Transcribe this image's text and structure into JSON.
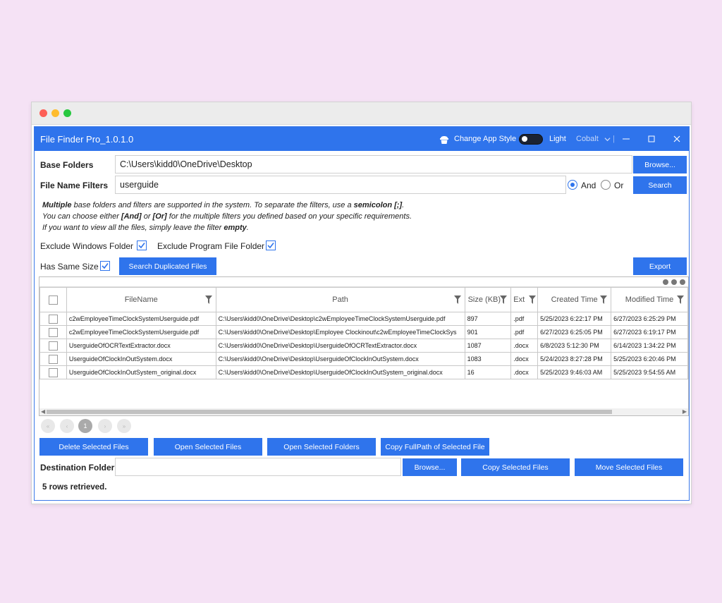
{
  "window": {
    "title": "File Finder Pro_1.0.1.0",
    "change_style_label": "Change App Style",
    "theme_label": "Light",
    "accent_label": "Cobalt",
    "accent_color": "#2f74ec"
  },
  "base_folders": {
    "label": "Base Folders",
    "value": "C:\\Users\\kidd0\\OneDrive\\Desktop",
    "browse_label": "Browse..."
  },
  "filters": {
    "label": "File Name Filters",
    "value": "userguide",
    "and_label": "And",
    "or_label": "Or",
    "selected": "And",
    "search_label": "Search"
  },
  "info": {
    "line1_b1": "Multiple",
    "line1_t1": " base folders and filters are supported in the system. To separate the filters, use a ",
    "line1_b2": "semicolon [;]",
    "line1_t2": ".",
    "line2_t1": "You can choose either ",
    "line2_b1": "[And]",
    "line2_t2": " or ",
    "line2_b2": "[Or]",
    "line2_t3": " for the multiple filters you defined based on your specific requirements.",
    "line3_t1": "If you want to view all the files, simply leave the filter ",
    "line3_b1": "empty",
    "line3_t2": "."
  },
  "options": {
    "exclude_windows_label": "Exclude Windows Folder",
    "exclude_windows": true,
    "exclude_program_label": "Exclude Program File Folder",
    "exclude_program": true,
    "same_size_label": "Has Same Size",
    "same_size": true,
    "search_duplicated_label": "Search Duplicated Files",
    "export_label": "Export"
  },
  "grid": {
    "columns": [
      "FileName",
      "Path",
      "Size (KB)",
      "Ext",
      "Created Time",
      "Modified Time"
    ],
    "rows": [
      [
        "c2wEmployeeTimeClockSystemUserguide.pdf",
        "C:\\Users\\kidd0\\OneDrive\\Desktop\\c2wEmployeeTimeClockSystemUserguide.pdf",
        "897",
        ".pdf",
        "5/25/2023 6:22:17 PM",
        "6/27/2023 6:25:29 PM"
      ],
      [
        "c2wEmployeeTimeClockSystemUserguide.pdf",
        "C:\\Users\\kidd0\\OneDrive\\Desktop\\Employee Clockinout\\c2wEmployeeTimeClockSys",
        "901",
        ".pdf",
        "6/27/2023 6:25:05 PM",
        "6/27/2023 6:19:17 PM"
      ],
      [
        "UserguideOfOCRTextExtractor.docx",
        "C:\\Users\\kidd0\\OneDrive\\Desktop\\UserguideOfOCRTextExtractor.docx",
        "1087",
        ".docx",
        "6/8/2023 5:12:30 PM",
        "6/14/2023 1:34:22 PM"
      ],
      [
        "UserguideOfClockInOutSystem.docx",
        "C:\\Users\\kidd0\\OneDrive\\Desktop\\UserguideOfClockInOutSystem.docx",
        "1083",
        ".docx",
        "5/24/2023 8:27:28 PM",
        "5/25/2023 6:20:46 PM"
      ],
      [
        "UserguideOfClockInOutSystem_original.docx",
        "C:\\Users\\kidd0\\OneDrive\\Desktop\\UserguideOfClockInOutSystem_original.docx",
        "16",
        ".docx",
        "5/25/2023 9:46:03 AM",
        "5/25/2023 9:54:55 AM"
      ]
    ]
  },
  "pagination": {
    "first": "«",
    "prev": "‹",
    "current": "1",
    "next": "›",
    "last": "»"
  },
  "actions": {
    "delete_label": "Delete Selected Files",
    "open_files_label": "Open Selected Files",
    "open_folders_label": "Open Selected Folders",
    "copy_path_label": "Copy FullPath of Selected File"
  },
  "destination": {
    "label": "Destination Folder",
    "value": "",
    "browse_label": "Browse...",
    "copy_label": "Copy Selected Files",
    "move_label": "Move Selected Files"
  },
  "status": "5 rows retrieved."
}
